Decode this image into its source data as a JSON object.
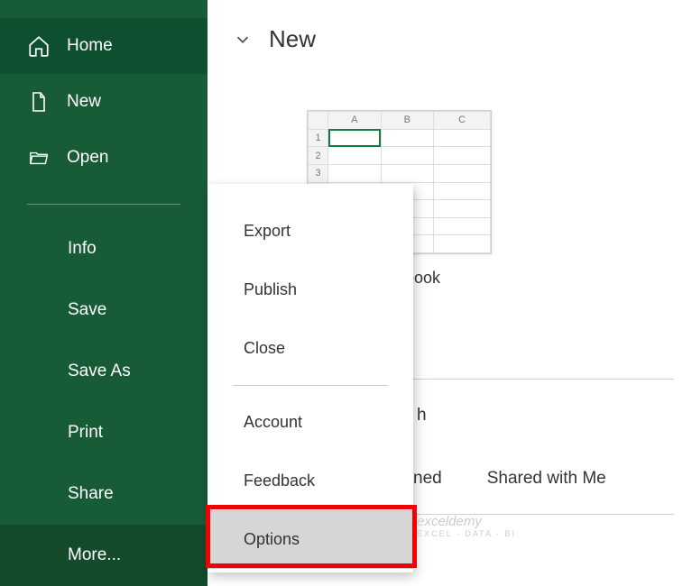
{
  "sidebar": {
    "home": "Home",
    "new": "New",
    "open": "Open",
    "info": "Info",
    "save": "Save",
    "saveas": "Save As",
    "print": "Print",
    "share": "Share",
    "more": "More..."
  },
  "main": {
    "section_title": "New",
    "thumb": {
      "cols": [
        "A",
        "B",
        "C"
      ],
      "rows": [
        "1",
        "2",
        "3"
      ],
      "label_suffix": "kbook"
    },
    "tabs": {
      "pinned_suffix": "ned",
      "shared": "Shared with Me"
    },
    "search_suffix": "h"
  },
  "flyout": {
    "export": "Export",
    "publish": "Publish",
    "close": "Close",
    "account": "Account",
    "feedback": "Feedback",
    "options": "Options"
  },
  "watermark": {
    "brand": "exceldemy",
    "tag": "EXCEL · DATA · BI"
  }
}
